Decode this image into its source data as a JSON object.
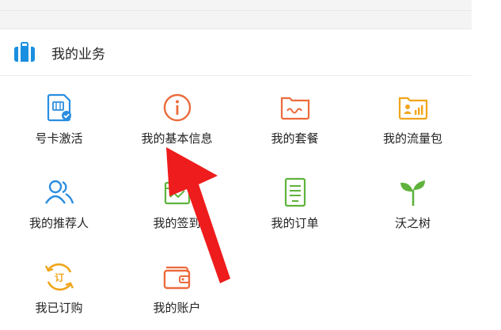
{
  "section": {
    "title": "我的业务",
    "icon": "briefcase-icon",
    "accent": "#1a8fe0"
  },
  "tiles": [
    {
      "label": "号卡激活",
      "icon": "sim-card-activate-icon",
      "color": "#2a8de0"
    },
    {
      "label": "我的基本信息",
      "icon": "info-circle-icon",
      "color": "#ec6b3c"
    },
    {
      "label": "我的套餐",
      "icon": "wallet-package-icon",
      "color": "#ec6b3c"
    },
    {
      "label": "我的流量包",
      "icon": "data-package-icon",
      "color": "#f0a519"
    },
    {
      "label": "我的推荐人",
      "icon": "people-icon",
      "color": "#2a8de0"
    },
    {
      "label": "我的签到",
      "icon": "sign-in-icon",
      "color": "#5fb33c"
    },
    {
      "label": "我的订单",
      "icon": "order-list-icon",
      "color": "#5fb33c"
    },
    {
      "label": "沃之树",
      "icon": "sprout-icon",
      "color": "#5fb33c"
    },
    {
      "label": "我已订购",
      "icon": "subscribed-icon",
      "color": "#f0a519"
    },
    {
      "label": "我的账户",
      "icon": "account-wallet-icon",
      "color": "#ec6b3c"
    }
  ],
  "annotation": {
    "icon": "red-arrow-pointer",
    "color": "#ee1c1c"
  }
}
